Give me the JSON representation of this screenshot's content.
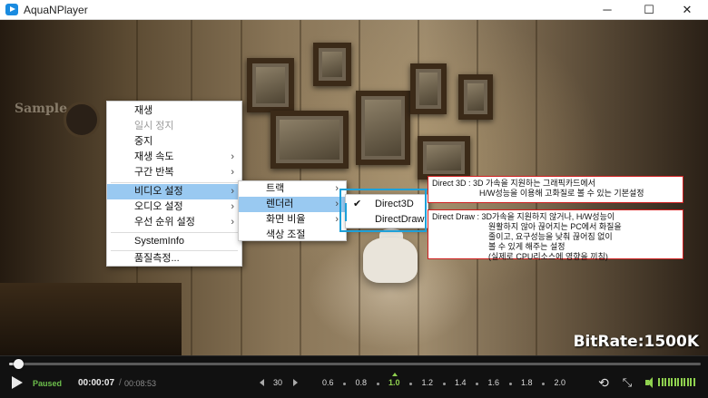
{
  "window": {
    "title": "AquaNPlayer",
    "minimize": "─",
    "maximize": "☐",
    "close": "✕"
  },
  "video": {
    "watermark": "Sample",
    "bitrate": "BitRate:1500K"
  },
  "context_menu": {
    "items": [
      {
        "label": "재생",
        "disabled": false,
        "submenu": false
      },
      {
        "label": "일시 정지",
        "disabled": true,
        "submenu": false
      },
      {
        "label": "중지",
        "disabled": false,
        "submenu": false
      },
      {
        "label": "재생 속도",
        "disabled": false,
        "submenu": true
      },
      {
        "label": "구간 반복",
        "disabled": false,
        "submenu": true
      },
      {
        "label": "비디오 설정",
        "disabled": false,
        "submenu": true,
        "highlighted": true
      },
      {
        "label": "오디오 설정",
        "disabled": false,
        "submenu": true
      },
      {
        "label": "우선 순위 설정",
        "disabled": false,
        "submenu": true
      },
      {
        "label": "SystemInfo",
        "disabled": false,
        "submenu": false
      },
      {
        "label": "품질측정...",
        "disabled": false,
        "submenu": false
      }
    ]
  },
  "video_submenu": {
    "items": [
      {
        "label": "트랙",
        "submenu": true
      },
      {
        "label": "렌더러",
        "submenu": true,
        "highlighted": true
      },
      {
        "label": "화면 비율",
        "submenu": true
      },
      {
        "label": "색상 조절",
        "submenu": false
      }
    ]
  },
  "renderer_submenu": {
    "items": [
      {
        "label": "Direct3D",
        "checked": true
      },
      {
        "label": "DirectDraw",
        "checked": false
      }
    ],
    "check_glyph": "✔"
  },
  "annotations": {
    "direct3d": {
      "line1": "Direct 3D : 3D 가속을 지원하는 그래픽카드에서",
      "line2": "H/W성능을 이용해 고화질로 볼 수 있는 기본설정"
    },
    "directdraw": {
      "line1": "Direct Draw : 3D가속을 지원하지 않거나, H/W성능이",
      "line2": "원활하지 않아 끊어지는 PC에서 화질을",
      "line3": "줄이고, 요구성능을 낮춰 끊어짐 없이",
      "line4": "볼 수 있게 해주는 설정",
      "line5": "(실제로 CPU리소스에 영향을 끼침)"
    }
  },
  "controls": {
    "status": "Paused",
    "current_time": "00:00:07",
    "separator": "/",
    "total_time": "00:08:53",
    "seek_fraction": 0.013,
    "skip_seconds": "30",
    "speeds": [
      "0.6",
      "0.8",
      "1.0",
      "1.2",
      "1.4",
      "1.6",
      "1.8",
      "2.0"
    ],
    "active_speed": "1.0",
    "repeat_icon": "⟲",
    "fullscreen_icon": "⤡",
    "volume_fraction": 1.0,
    "colors": {
      "accent_green": "#8fd14f",
      "menu_highlight": "#99c9f1",
      "annotation_border": "#d02020",
      "connector": "#1ea0d8"
    }
  }
}
